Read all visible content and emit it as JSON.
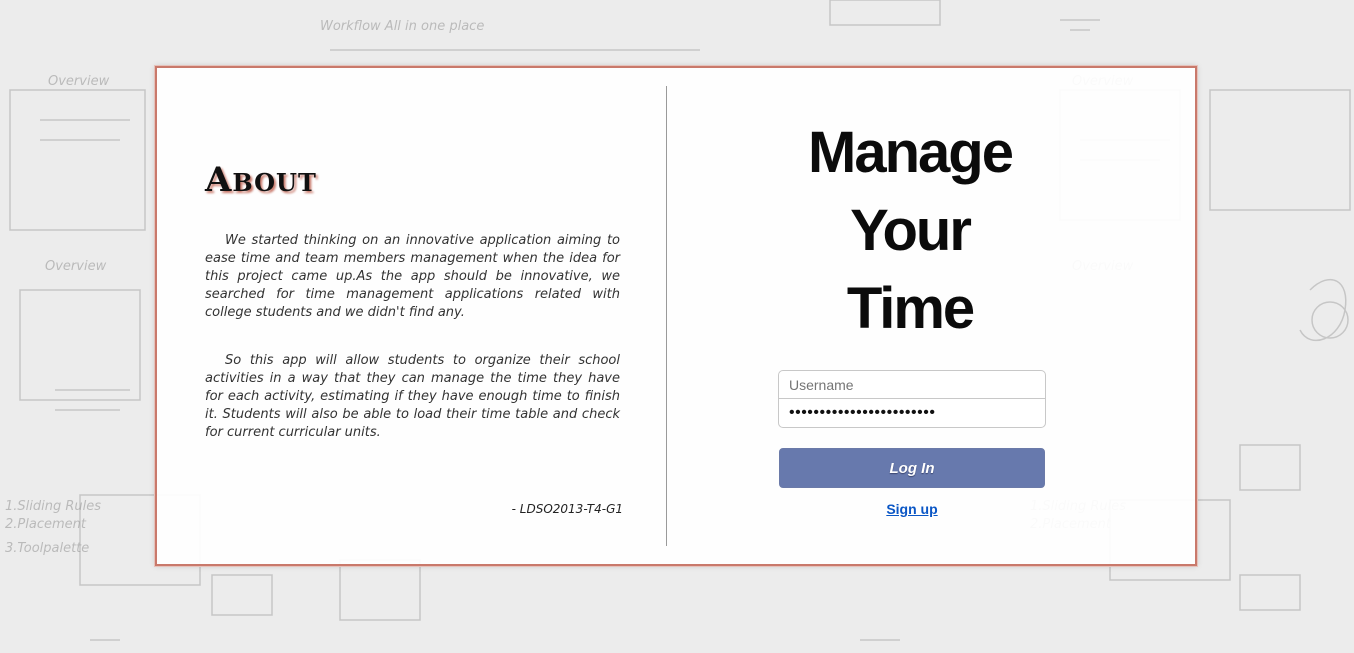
{
  "about": {
    "title": "About",
    "paragraph1": "We started thinking on an innovative application aiming to ease time and team members management when the idea for this project came up.As the app should be innovative, we searched for time management applications related with college students and we didn't find any.",
    "paragraph2": "So this app will allow students to organize their school activities in a way that they can manage the time they have for each activity, estimating if they have enough time to finish it. Students will also be able to load their time table and check for current curricular units.",
    "signature": "- LDSO2013-T4-G1"
  },
  "hero": {
    "line1": "Manage",
    "line2": "Your",
    "line3": "Time"
  },
  "login": {
    "username_placeholder": "Username",
    "password_value": "••••••••••••••••••••••••",
    "login_label": "Log In",
    "signup_label": "Sign up"
  },
  "colors": {
    "card_border": "#c9796b",
    "button_bg": "#6779ad",
    "link": "#0a56c5"
  }
}
